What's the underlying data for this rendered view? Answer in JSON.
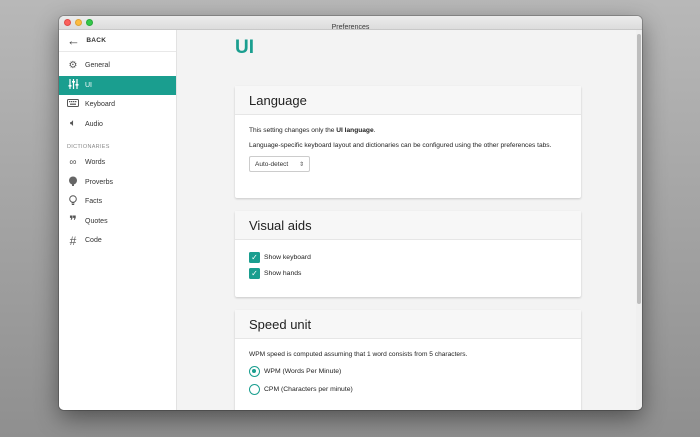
{
  "window": {
    "title": "Preferences"
  },
  "sidebar": {
    "back_label": "BACK",
    "items": [
      {
        "label": "General",
        "icon": "gear-icon"
      },
      {
        "label": "UI",
        "icon": "sliders-icon",
        "active": true
      },
      {
        "label": "Keyboard",
        "icon": "keyboard-icon"
      },
      {
        "label": "Audio",
        "icon": "speaker-icon"
      }
    ],
    "section_label": "DICTIONARIES",
    "dict_items": [
      {
        "label": "Words",
        "icon": "infinity-icon"
      },
      {
        "label": "Proverbs",
        "icon": "brain-icon"
      },
      {
        "label": "Facts",
        "icon": "lightbulb-icon"
      },
      {
        "label": "Quotes",
        "icon": "quote-icon"
      },
      {
        "label": "Code",
        "icon": "hash-icon"
      }
    ]
  },
  "main": {
    "page_title": "UI",
    "language": {
      "heading": "Language",
      "text_prefix": "This setting changes only the ",
      "text_bold": "UI language",
      "text_suffix": ".",
      "text2": "Language-specific keyboard layout and dictionaries can be configured using the other preferences tabs.",
      "select_value": "Auto-detect"
    },
    "visual_aids": {
      "heading": "Visual aids",
      "options": [
        {
          "label": "Show keyboard",
          "checked": true
        },
        {
          "label": "Show hands",
          "checked": true
        }
      ]
    },
    "speed_unit": {
      "heading": "Speed unit",
      "text": "WPM speed is computed assuming that 1 word consists from 5 characters.",
      "options": [
        {
          "label": "WPM (Words Per Minute)",
          "selected": true
        },
        {
          "label": "CPM (Characters per minute)",
          "selected": false
        }
      ]
    }
  },
  "colors": {
    "accent": "#1a9e8f"
  }
}
